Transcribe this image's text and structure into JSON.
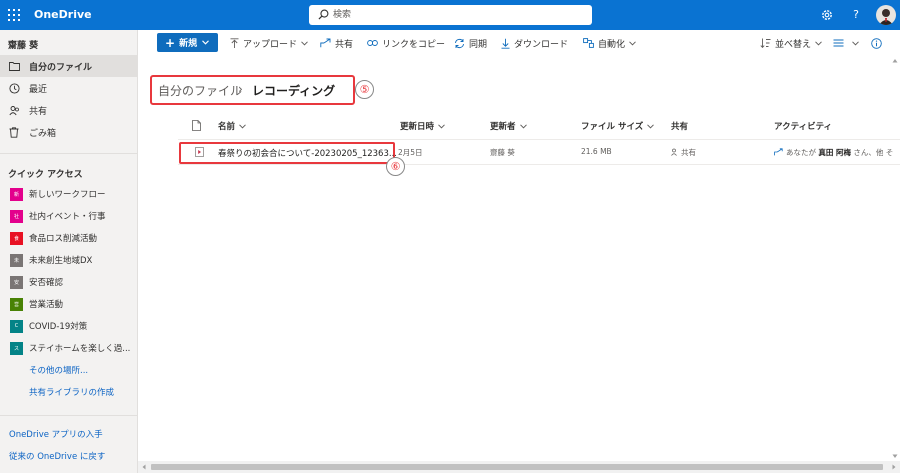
{
  "app": {
    "brand": "OneDrive"
  },
  "search": {
    "placeholder": "検索"
  },
  "topbar": {
    "help": "?"
  },
  "sidebar": {
    "user": "齋藤 葵",
    "nav": [
      {
        "label": "自分のファイル",
        "icon": "folder-icon",
        "active": true
      },
      {
        "label": "最近",
        "icon": "clock-icon"
      },
      {
        "label": "共有",
        "icon": "people-icon"
      },
      {
        "label": "ごみ箱",
        "icon": "trash-icon"
      }
    ],
    "quick_access": "クイック アクセス",
    "sites": [
      {
        "label": "新しいワークフロー",
        "abbr": "新",
        "color": "#e3008c"
      },
      {
        "label": "社内イベント・行事",
        "abbr": "社",
        "color": "#e3008c"
      },
      {
        "label": "食品ロス削減活動",
        "abbr": "食",
        "color": "#e81123"
      },
      {
        "label": "未来創生地域DX",
        "abbr": "未",
        "color": "#7a7574"
      },
      {
        "label": "安否確認",
        "abbr": "安",
        "color": "#7a7574"
      },
      {
        "label": "営業活動",
        "abbr": "営",
        "color": "#498205"
      },
      {
        "label": "COVID-19対策",
        "abbr": "C",
        "color": "#038387"
      },
      {
        "label": "ステイホームを楽しく過...",
        "abbr": "ス",
        "color": "#038387"
      }
    ],
    "more_places": "その他の場所...",
    "create_library": "共有ライブラリの作成",
    "get_app": "OneDrive アプリの入手",
    "classic": "従来の OneDrive に戻す"
  },
  "commands": {
    "new": "新規",
    "upload": "アップロード",
    "share": "共有",
    "copy_link": "リンクをコピー",
    "sync": "同期",
    "download": "ダウンロード",
    "automate": "自動化",
    "sort": "並べ替え"
  },
  "breadcrumb": {
    "root": "自分のファイル",
    "separator": "›",
    "current": "レコーディング",
    "callout": "⑤"
  },
  "table": {
    "headers": {
      "name": "名前",
      "modified": "更新日時",
      "modified_by": "更新者",
      "size": "ファイル サイズ",
      "sharing": "共有",
      "activity": "アクティビティ"
    },
    "rows": [
      {
        "name": "春祭りの初会合について-20230205_12363...",
        "modified": "2月5日",
        "modified_by": "齋藤 葵",
        "size": "21.6 MB",
        "sharing": "共有",
        "activity_prefix": "あなたが",
        "activity_person": "真田 阿梅",
        "activity_suffix": "さん、他 そ"
      }
    ],
    "callout": "⑥"
  },
  "colors": {
    "topbar": "#0a73d2",
    "primary_button": "#0f6cbd",
    "highlight_box": "#e8383d",
    "sidebar_bg": "#f3f2f1"
  }
}
